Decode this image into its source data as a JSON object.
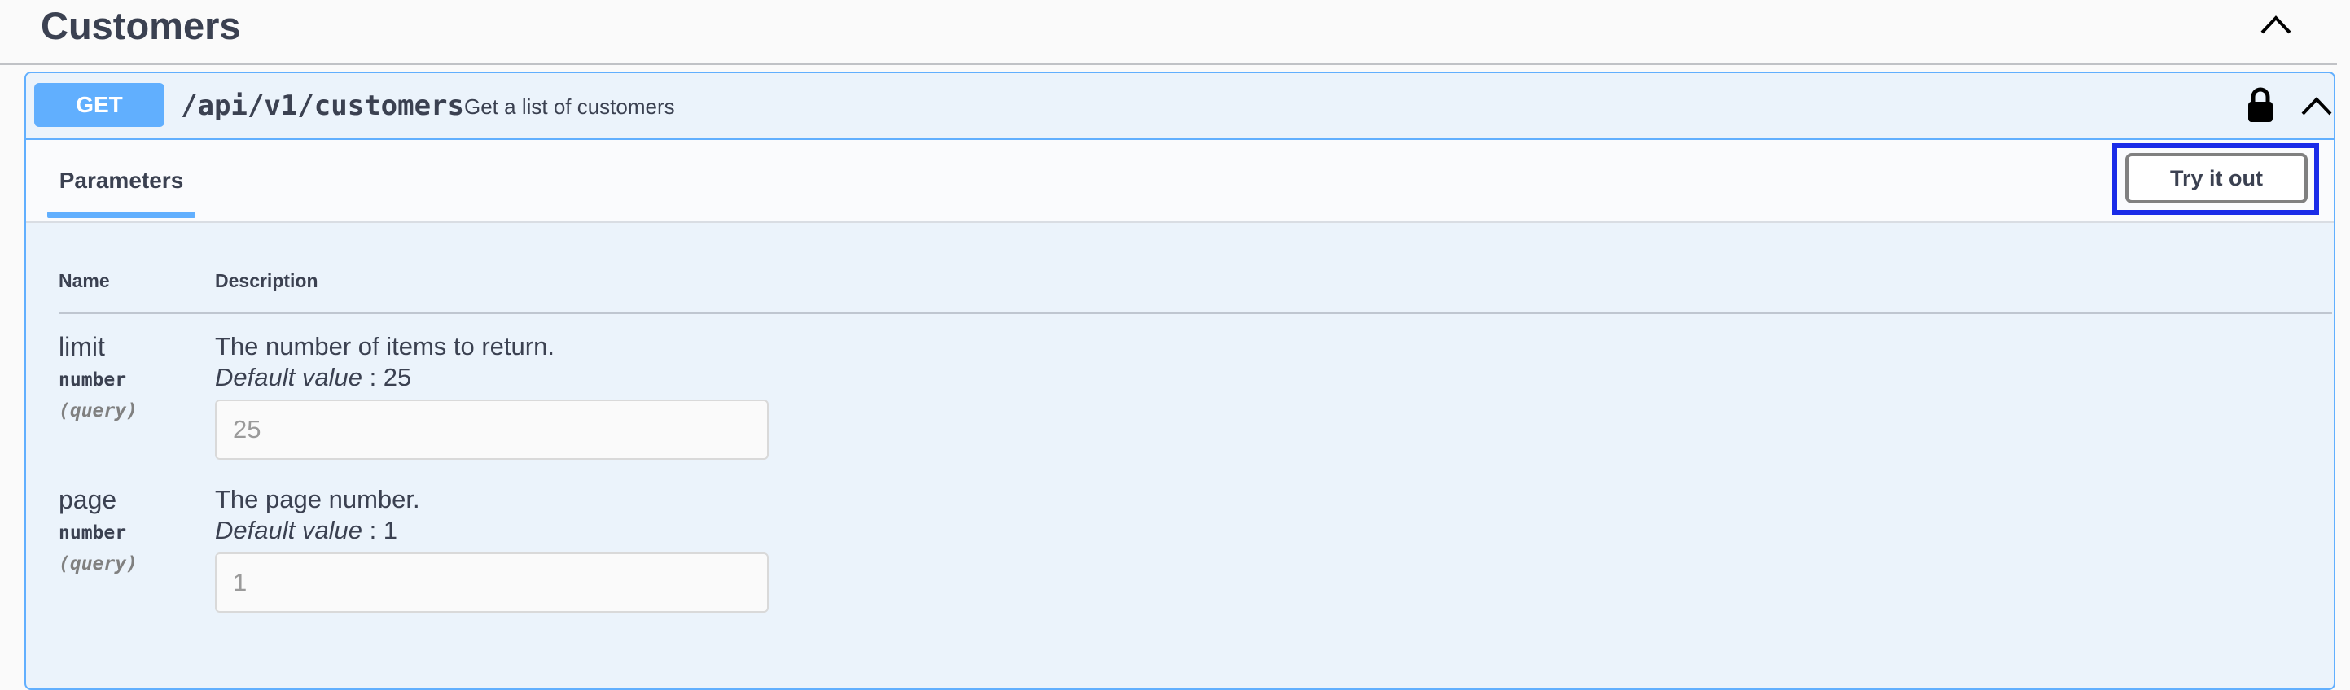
{
  "tag": {
    "title": "Customers",
    "collapse_icon": "chevron-up-icon"
  },
  "operation": {
    "method": "GET",
    "path": "/api/v1/customers",
    "summary": "Get a list of customers",
    "lock_icon": "lock-icon",
    "collapse_icon": "chevron-up-icon",
    "method_color": "#61affe",
    "block_bg": "#ebf3fb"
  },
  "section": {
    "tab_label": "Parameters",
    "try_button_label": "Try it out",
    "highlight_color": "#1a2ce8"
  },
  "table": {
    "headers": {
      "name": "Name",
      "description": "Description"
    },
    "params": [
      {
        "name": "limit",
        "type": "number",
        "location": "(query)",
        "description": "The number of items to return.",
        "default_label": "Default value",
        "default_value": ": 25",
        "placeholder": "25"
      },
      {
        "name": "page",
        "type": "number",
        "location": "(query)",
        "description": "The page number.",
        "default_label": "Default value",
        "default_value": ": 1",
        "placeholder": "1"
      }
    ]
  }
}
